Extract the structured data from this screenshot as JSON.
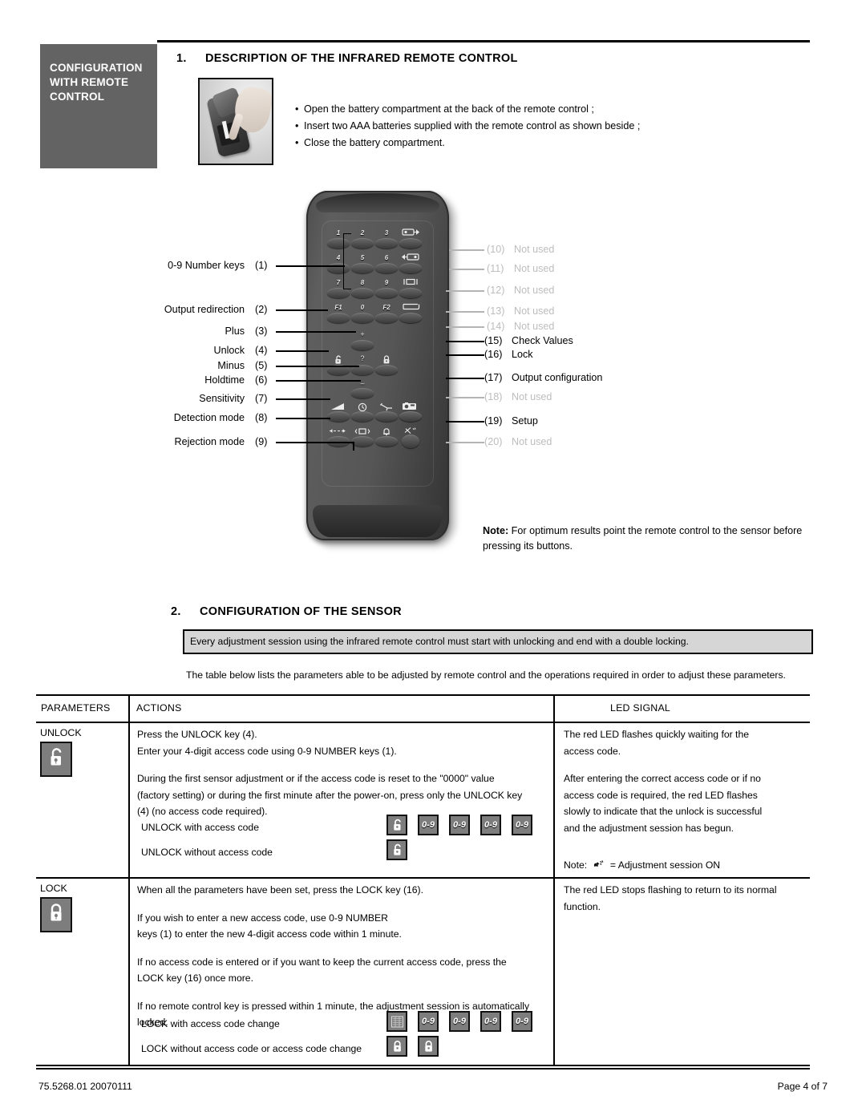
{
  "sidebar": {
    "line1": "CONFIGURATION",
    "line2": "WITH REMOTE",
    "line3": "CONTROL"
  },
  "section1": {
    "number": "1.",
    "title": "DESCRIPTION OF THE INFRARED REMOTE CONTROL",
    "bullets": [
      "Open the battery compartment at the back of the remote control ;",
      "Insert two AAA batteries supplied with the remote control as shown beside ;",
      "Close the battery compartment."
    ],
    "photo_caption": "battery-compartment-photo"
  },
  "remote": {
    "left_labels": [
      {
        "num": "(1)",
        "text": "0-9 Number keys"
      },
      {
        "num": "(2)",
        "text": "Output redirection"
      },
      {
        "num": "(3)",
        "text": "Plus"
      },
      {
        "num": "(4)",
        "text": "Unlock"
      },
      {
        "num": "(5)",
        "text": "Minus"
      },
      {
        "num": "(6)",
        "text": "Holdtime"
      },
      {
        "num": "(7)",
        "text": "Sensitivity"
      },
      {
        "num": "(8)",
        "text": "Detection mode"
      },
      {
        "num": "(9)",
        "text": "Rejection mode"
      }
    ],
    "right_labels": [
      {
        "num": "(10)",
        "text": "Not used",
        "used": false
      },
      {
        "num": "(11)",
        "text": "Not used",
        "used": false
      },
      {
        "num": "(12)",
        "text": "Not used",
        "used": false
      },
      {
        "num": "(13)",
        "text": "Not used",
        "used": false
      },
      {
        "num": "(14)",
        "text": "Not used",
        "used": false
      },
      {
        "num": "(15)",
        "text": "Check Values",
        "used": true
      },
      {
        "num": "(16)",
        "text": "Lock",
        "used": true
      },
      {
        "num": "(17)",
        "text": "Output configuration",
        "used": true
      },
      {
        "num": "(18)",
        "text": "Not used",
        "used": false
      },
      {
        "num": "(19)",
        "text": "Setup",
        "used": true
      },
      {
        "num": "(20)",
        "text": "Not used",
        "used": false
      }
    ],
    "keypad_labels": [
      "1",
      "2",
      "3",
      "4",
      "5",
      "6",
      "7",
      "8",
      "9",
      "F1",
      "0",
      "F2"
    ],
    "note": "Note: For optimum results point the remote control to the sensor before pressing its buttons.",
    "note_prefix": "Note:",
    "note_body": " For optimum results point the remote control to the sensor before pressing its buttons."
  },
  "section2": {
    "number": "2.",
    "title": "CONFIGURATION OF THE SENSOR",
    "highlight": "Every adjustment session using the infrared remote control must start with unlocking and end with a double locking.",
    "intro": "The table below lists the parameters able to be adjusted by remote control and the operations required in order to adjust these parameters."
  },
  "table": {
    "headers": {
      "parameters": "PARAMETERS",
      "actions": "ACTIONS",
      "led_signal": "LED SIGNAL"
    },
    "rows": [
      {
        "parameter": "UNLOCK",
        "icon": "unlock-icon",
        "actions_p1_l1": "Press the UNLOCK key (4).",
        "actions_p1_l2": "Enter your 4-digit access code using 0-9 NUMBER keys (1).",
        "actions_p2_l1": "During  the first sensor adjustment or if the access code is reset to the \"0000\" value",
        "actions_p2_l2": "(factory setting) or during the first minute after the power-on, press only the UNLOCK key",
        "actions_p2_l3": "(4) (no access code required).",
        "seq1_label": "UNLOCK with access code",
        "seq2_label": "UNLOCK without access code",
        "seq1_keys": [
          "unlock-icon",
          "0-9",
          "0-9",
          "0-9",
          "0-9"
        ],
        "seq2_keys": [
          "unlock-icon"
        ],
        "led_p1_l1": "The red LED flashes quickly waiting for the",
        "led_p1_l2": "access code.",
        "led_p2_l1": "After entering the correct access code or if no",
        "led_p2_l2": "access code is required, the red LED flashes",
        "led_p2_l3": "slowly to indicate that the unlock is successful",
        "led_p2_l4": "and the adjustment session has begun.",
        "led_note_prefix": "Note:",
        "led_note_suffix": "= Adjustment session ON"
      },
      {
        "parameter": "LOCK",
        "icon": "lock-icon",
        "actions_p1_l1": "When all the parameters have been set, press the LOCK key (16).",
        "actions_p2_l1": "If you wish to enter a new access code, use 0-9 NUMBER",
        "actions_p2_l2": "keys (1) to enter the new 4-digit access code within 1 minute.",
        "actions_p3_l1": "If no access code is entered or if you want to keep the current access code, press the",
        "actions_p3_l2": "LOCK key (16) once more.",
        "actions_p4_l1": "If no remote control key is pressed within 1 minute, the adjustment session is automatically",
        "actions_p4_l2": "locked.",
        "seq1_label": "LOCK with access code change",
        "seq2_label": "LOCK without access code or access code change",
        "seq1_keys": [
          "setup-icon",
          "0-9",
          "0-9",
          "0-9",
          "0-9"
        ],
        "seq2_keys": [
          "lock-icon",
          "lock-icon"
        ],
        "led_p1_l1": "The red LED stops flashing to return to its normal",
        "led_p1_l2": "function."
      }
    ]
  },
  "footer": {
    "left": "75.5268.01 20070111",
    "right": "Page 4 of 7"
  },
  "colors": {
    "sidebar_bg": "#636363",
    "highlight_bg": "#d6d6d6",
    "chip_bg": "#7d7d7d",
    "muted_text": "#bdbdbd"
  }
}
